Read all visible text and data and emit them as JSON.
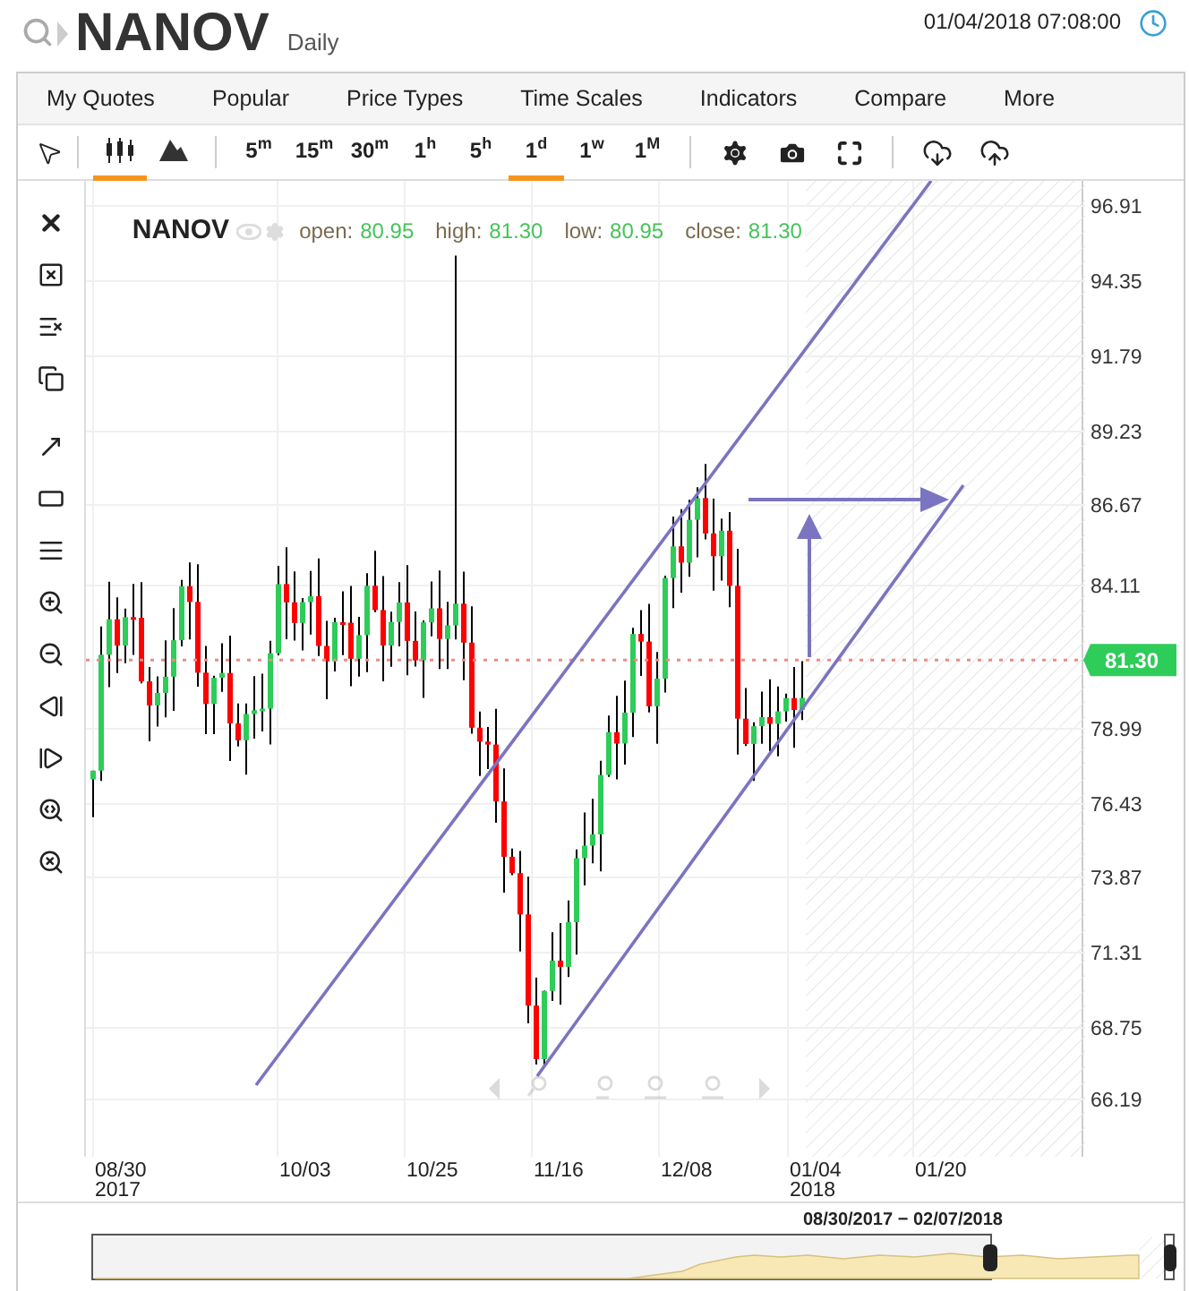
{
  "header": {
    "symbol": "NANOV",
    "interval": "Daily",
    "datetime": "01/04/2018 07:08:00"
  },
  "menu": [
    "My Quotes",
    "Popular",
    "Price Types",
    "Time Scales",
    "Indicators",
    "Compare",
    "More"
  ],
  "chart_types": [
    {
      "kind": "candles",
      "selected": true
    },
    {
      "kind": "area",
      "selected": false
    }
  ],
  "timeframes": [
    {
      "value": "5",
      "unit": "m",
      "selected": false
    },
    {
      "value": "15",
      "unit": "m",
      "selected": false
    },
    {
      "value": "30",
      "unit": "m",
      "selected": false
    },
    {
      "value": "1",
      "unit": "h",
      "selected": false
    },
    {
      "value": "5",
      "unit": "h",
      "selected": false
    },
    {
      "value": "1",
      "unit": "d",
      "selected": true
    },
    {
      "value": "1",
      "unit": "w",
      "selected": false
    },
    {
      "value": "1",
      "unit": "M",
      "selected": false
    }
  ],
  "legend": {
    "symbol": "NANOV",
    "fields": [
      {
        "label": "open:",
        "value": "80.95"
      },
      {
        "label": "high:",
        "value": "81.30"
      },
      {
        "label": "low:",
        "value": "80.95"
      },
      {
        "label": "close:",
        "value": "81.30"
      }
    ]
  },
  "price_axis": {
    "labels": [
      "96.91",
      "94.35",
      "91.79",
      "89.23",
      "86.67",
      "84.11",
      "78.99",
      "76.43",
      "73.87",
      "71.31",
      "68.75",
      "66.19"
    ],
    "last_price": "81.30"
  },
  "date_axis": [
    {
      "date": "08/30",
      "year": "2017"
    },
    {
      "date": "10/03"
    },
    {
      "date": "10/25"
    },
    {
      "date": "11/16"
    },
    {
      "date": "12/08"
    },
    {
      "date": "01/04",
      "year": "2018"
    },
    {
      "date": "01/20"
    }
  ],
  "navigator": {
    "range": "08/30/2017 − 02/07/2018"
  }
}
